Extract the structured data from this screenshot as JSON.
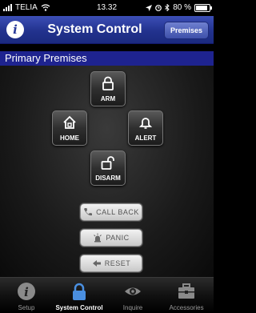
{
  "status_bar": {
    "carrier": "TELIA",
    "time": "13.32",
    "battery": "80 %"
  },
  "navbar": {
    "info_label": "i",
    "title": "System Control",
    "right_button": "Premises"
  },
  "section": {
    "title": "Primary Premises"
  },
  "commands": {
    "arm": "ARM",
    "home": "HOME",
    "alert": "ALERT",
    "disarm": "DISARM"
  },
  "actions": {
    "callback": "CALL BACK",
    "panic": "PANIC",
    "reset": "RESET"
  },
  "tabs": [
    {
      "label": "Setup",
      "icon": "info-icon"
    },
    {
      "label": "System Control",
      "icon": "lock-icon",
      "active": true
    },
    {
      "label": "Inquire",
      "icon": "eye-icon"
    },
    {
      "label": "Accessories",
      "icon": "toolbox-icon"
    }
  ],
  "colors": {
    "navbar": "#22328e",
    "section_header": "#1e238f",
    "active_tab_icon": "#4a8fe0"
  }
}
